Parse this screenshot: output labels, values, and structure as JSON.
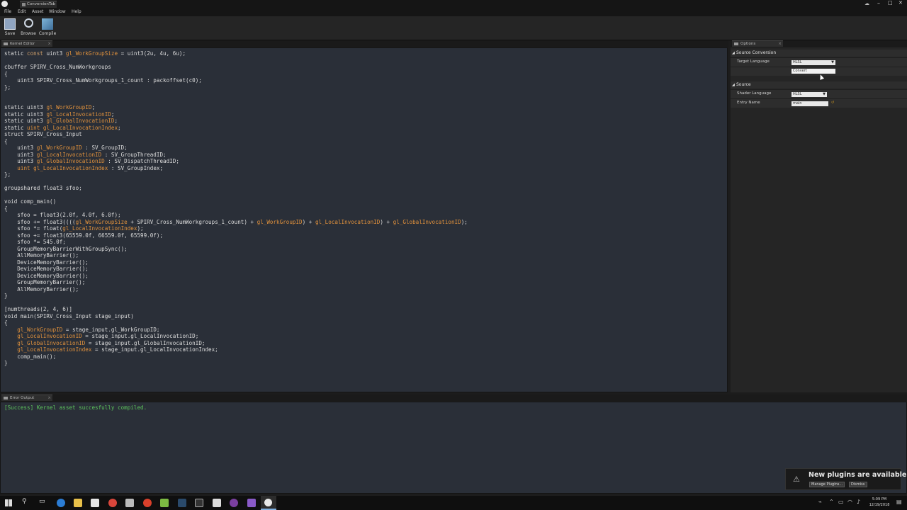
{
  "window": {
    "title": "ConversionTab"
  },
  "menu": [
    "File",
    "Edit",
    "Asset",
    "Window",
    "Help"
  ],
  "toolbar": {
    "save": "Save",
    "browse": "Browse",
    "compile": "Compile"
  },
  "tabs": {
    "kernel_editor": "Kernel Editor",
    "options": "Options",
    "error_output": "Error Output"
  },
  "code_lines": [
    [
      {
        "t": "static ",
        "c": ""
      },
      {
        "t": "const",
        "c": "kw"
      },
      {
        "t": " uint3 ",
        "c": ""
      },
      {
        "t": "gl_WorkGroupSize",
        "c": "orn"
      },
      {
        "t": " = uint3(2u, 4u, 6u);",
        "c": ""
      }
    ],
    [],
    [
      {
        "t": "cbuffer SPIRV_Cross_NumWorkgroups",
        "c": ""
      }
    ],
    [
      {
        "t": "{",
        "c": ""
      }
    ],
    [
      {
        "t": "    uint3 SPIRV_Cross_NumWorkgroups_1_count : packoffset(c0);",
        "c": ""
      }
    ],
    [
      {
        "t": "};",
        "c": ""
      }
    ],
    [],
    [],
    [
      {
        "t": "static uint3 ",
        "c": ""
      },
      {
        "t": "gl_WorkGroupID",
        "c": "orn"
      },
      {
        "t": ";",
        "c": ""
      }
    ],
    [
      {
        "t": "static uint3 ",
        "c": ""
      },
      {
        "t": "gl_LocalInvocationID",
        "c": "orn"
      },
      {
        "t": ";",
        "c": ""
      }
    ],
    [
      {
        "t": "static uint3 ",
        "c": ""
      },
      {
        "t": "gl_GlobalInvocationID",
        "c": "orn"
      },
      {
        "t": ";",
        "c": ""
      }
    ],
    [
      {
        "t": "static ",
        "c": ""
      },
      {
        "t": "uint gl_LocalInvocationIndex",
        "c": "orn"
      },
      {
        "t": ";",
        "c": ""
      }
    ],
    [
      {
        "t": "struct SPIRV_Cross_Input",
        "c": ""
      }
    ],
    [
      {
        "t": "{",
        "c": ""
      }
    ],
    [
      {
        "t": "    uint3 ",
        "c": ""
      },
      {
        "t": "gl_WorkGroupID",
        "c": "orn"
      },
      {
        "t": " : SV_GroupID;",
        "c": ""
      }
    ],
    [
      {
        "t": "    uint3 ",
        "c": ""
      },
      {
        "t": "gl_LocalInvocationID",
        "c": "orn"
      },
      {
        "t": " : SV_GroupThreadID;",
        "c": ""
      }
    ],
    [
      {
        "t": "    uint3 ",
        "c": ""
      },
      {
        "t": "gl_GlobalInvocationID",
        "c": "orn"
      },
      {
        "t": " : SV_DispatchThreadID;",
        "c": ""
      }
    ],
    [
      {
        "t": "    ",
        "c": ""
      },
      {
        "t": "uint gl_LocalInvocationIndex",
        "c": "orn"
      },
      {
        "t": " : SV_GroupIndex;",
        "c": ""
      }
    ],
    [
      {
        "t": "};",
        "c": ""
      }
    ],
    [],
    [
      {
        "t": "groupshared float3 sfoo;",
        "c": ""
      }
    ],
    [],
    [
      {
        "t": "void comp_main()",
        "c": ""
      }
    ],
    [
      {
        "t": "{",
        "c": ""
      }
    ],
    [
      {
        "t": "    sfoo = float3(2.0f, 4.0f, 6.0f);",
        "c": ""
      }
    ],
    [
      {
        "t": "    sfoo += float3((((",
        "c": ""
      },
      {
        "t": "gl_WorkGroupSize",
        "c": "orn"
      },
      {
        "t": " + SPIRV_Cross_NumWorkgroups_1_count) + ",
        "c": ""
      },
      {
        "t": "gl_WorkGroupID",
        "c": "orn"
      },
      {
        "t": ") + ",
        "c": ""
      },
      {
        "t": "gl_LocalInvocationID",
        "c": "orn"
      },
      {
        "t": ") + ",
        "c": ""
      },
      {
        "t": "gl_GlobalInvocationID",
        "c": "orn"
      },
      {
        "t": ");",
        "c": ""
      }
    ],
    [
      {
        "t": "    sfoo *= float(",
        "c": ""
      },
      {
        "t": "gl_LocalInvocationIndex",
        "c": "orn"
      },
      {
        "t": ");",
        "c": ""
      }
    ],
    [
      {
        "t": "    sfoo += float3(65559.0f, 66559.0f, 65599.0f);",
        "c": ""
      }
    ],
    [
      {
        "t": "    sfoo *= 545.0f;",
        "c": ""
      }
    ],
    [
      {
        "t": "    GroupMemoryBarrierWithGroupSync();",
        "c": ""
      }
    ],
    [
      {
        "t": "    AllMemoryBarrier();",
        "c": ""
      }
    ],
    [
      {
        "t": "    DeviceMemoryBarrier();",
        "c": ""
      }
    ],
    [
      {
        "t": "    DeviceMemoryBarrier();",
        "c": ""
      }
    ],
    [
      {
        "t": "    DeviceMemoryBarrier();",
        "c": ""
      }
    ],
    [
      {
        "t": "    GroupMemoryBarrier();",
        "c": ""
      }
    ],
    [
      {
        "t": "    AllMemoryBarrier();",
        "c": ""
      }
    ],
    [
      {
        "t": "}",
        "c": ""
      }
    ],
    [],
    [
      {
        "t": "[numthreads(2, 4, 6)]",
        "c": ""
      }
    ],
    [
      {
        "t": "void main(SPIRV_Cross_Input stage_input)",
        "c": ""
      }
    ],
    [
      {
        "t": "{",
        "c": ""
      }
    ],
    [
      {
        "t": "    ",
        "c": ""
      },
      {
        "t": "gl_WorkGroupID",
        "c": "orn"
      },
      {
        "t": " = stage_input.gl_WorkGroupID;",
        "c": ""
      }
    ],
    [
      {
        "t": "    ",
        "c": ""
      },
      {
        "t": "gl_LocalInvocationID",
        "c": "orn"
      },
      {
        "t": " = stage_input.gl_LocalInvocationID;",
        "c": ""
      }
    ],
    [
      {
        "t": "    ",
        "c": ""
      },
      {
        "t": "gl_GlobalInvocationID",
        "c": "orn"
      },
      {
        "t": " = stage_input.gl_GlobalInvocationID;",
        "c": ""
      }
    ],
    [
      {
        "t": "    ",
        "c": ""
      },
      {
        "t": "gl_LocalInvocationIndex",
        "c": "orn"
      },
      {
        "t": " = stage_input.gl_LocalInvocationIndex;",
        "c": ""
      }
    ],
    [
      {
        "t": "    comp_main();",
        "c": ""
      }
    ],
    [
      {
        "t": "}",
        "c": ""
      }
    ]
  ],
  "options": {
    "source_conversion": {
      "header": "Source Conversion",
      "target_language_label": "Target Language",
      "target_language_value": "HLSL",
      "convert_button": "Convert"
    },
    "source": {
      "header": "Source",
      "shader_language_label": "Shader Language",
      "shader_language_value": "HLSL",
      "entry_name_label": "Entry Name",
      "entry_name_value": "main"
    }
  },
  "error_output": {
    "message": "[Success] Kernel asset succesfully compiled."
  },
  "notification": {
    "title": "New plugins are available",
    "manage_button": "Manage Plugins...",
    "dismiss_button": "Dismiss"
  },
  "clock": {
    "time": "5:09 PM",
    "date": "12/19/2018"
  },
  "colors": {
    "code_bg": "#2a2f38",
    "keyword": "#d3a26b",
    "identifier": "#e0913c",
    "success": "#5cc45c"
  }
}
